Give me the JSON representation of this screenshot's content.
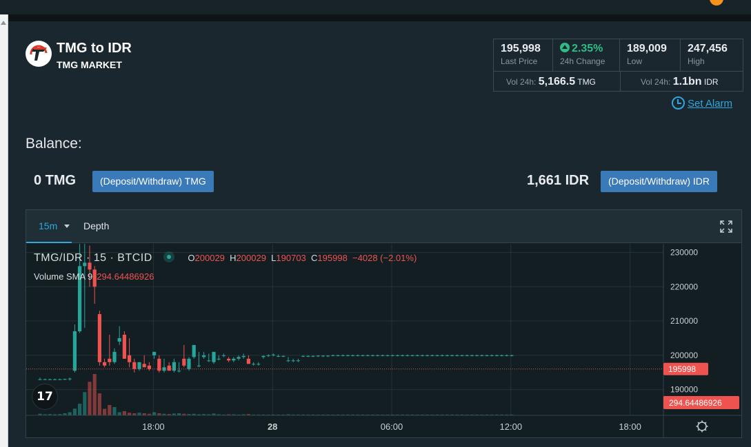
{
  "header": {
    "title": "TMG to IDR",
    "subtitle": "TMG MARKET"
  },
  "stats": {
    "last_price": "195,998",
    "last_price_label": "Last Price",
    "change": "2.35%",
    "change_label": "24h Change",
    "low": "189,009",
    "low_label": "Low",
    "high": "247,456",
    "high_label": "High",
    "vol_label_1": "Vol 24h:",
    "vol_base": "5,166.5",
    "vol_base_unit": "TMG",
    "vol_label_2": "Vol 24h:",
    "vol_quote": "1.1bn",
    "vol_quote_unit": "IDR"
  },
  "alarm_label": "Set Alarm",
  "balance": {
    "title": "Balance:",
    "base_amount": "0 TMG",
    "base_button": "(Deposit/Withdraw) TMG",
    "quote_amount": "1,661 IDR",
    "quote_button": "(Deposit/Withdraw) IDR"
  },
  "chart_tabs": {
    "interval": "15m",
    "depth": "Depth"
  },
  "legend": {
    "symbol": "TMG/IDR · 15 · BTCID",
    "o_label": "O",
    "o": "200029",
    "h_label": "H",
    "h": "200029",
    "l_label": "L",
    "l": "190703",
    "c_label": "C",
    "c": "195998",
    "change": "−4028 (−2.01%)",
    "volume_label": "Volume SMA 9",
    "volume_value": "294.64486926"
  },
  "colors": {
    "up": "#26a69a",
    "down": "#ef5350",
    "accent": "#2ea8de",
    "button": "#3a7ab8"
  },
  "chart_data": {
    "type": "candlestick",
    "price_axis": {
      "ticks": [
        190000,
        200000,
        210000,
        220000,
        230000
      ],
      "tick_labels": [
        "190000",
        "200000",
        "210000",
        "220000",
        "230000"
      ],
      "range": [
        182500,
        232500
      ]
    },
    "time_axis": {
      "labels": [
        "18:00",
        "28",
        "06:00",
        "12:00",
        "18:00"
      ],
      "label_index": [
        12,
        36,
        60,
        84,
        108
      ]
    },
    "last_price_label": "195998",
    "last_price": 195998,
    "volume_label": "294.64486926",
    "candles": [
      {
        "o": 193000,
        "h": 193500,
        "l": 192800,
        "c": 193000,
        "v": 6
      },
      {
        "o": 193000,
        "h": 193200,
        "l": 192800,
        "c": 193000,
        "v": 4
      },
      {
        "o": 193000,
        "h": 193200,
        "l": 192800,
        "c": 193000,
        "v": 5
      },
      {
        "o": 193000,
        "h": 193200,
        "l": 192800,
        "c": 193000,
        "v": 4
      },
      {
        "o": 193000,
        "h": 193200,
        "l": 192800,
        "c": 193000,
        "v": 5
      },
      {
        "o": 193000,
        "h": 193200,
        "l": 192800,
        "c": 193100,
        "v": 8
      },
      {
        "o": 193000,
        "h": 193500,
        "l": 192600,
        "c": 193200,
        "v": 12
      },
      {
        "o": 195500,
        "h": 209000,
        "l": 195000,
        "c": 207000,
        "v": 26
      },
      {
        "o": 207000,
        "h": 233000,
        "l": 206500,
        "c": 226000,
        "v": 45
      },
      {
        "o": 226000,
        "h": 233000,
        "l": 208000,
        "c": 227000,
        "v": 90
      },
      {
        "o": 227000,
        "h": 232000,
        "l": 220000,
        "c": 225000,
        "v": 130
      },
      {
        "o": 225000,
        "h": 226000,
        "l": 215000,
        "c": 220000,
        "v": 160
      },
      {
        "o": 212000,
        "h": 213000,
        "l": 197000,
        "c": 198000,
        "v": 85
      },
      {
        "o": 198000,
        "h": 199000,
        "l": 196500,
        "c": 197000,
        "v": 25
      },
      {
        "o": 199000,
        "h": 206000,
        "l": 197000,
        "c": 198000,
        "v": 40
      },
      {
        "o": 198000,
        "h": 202000,
        "l": 197500,
        "c": 201000,
        "v": 32
      },
      {
        "o": 204000,
        "h": 208500,
        "l": 203000,
        "c": 205000,
        "v": 12
      },
      {
        "o": 206000,
        "h": 207000,
        "l": 199000,
        "c": 199000,
        "v": 16
      },
      {
        "o": 200000,
        "h": 205000,
        "l": 196500,
        "c": 198000,
        "v": 10
      },
      {
        "o": 198000,
        "h": 199000,
        "l": 195000,
        "c": 196000,
        "v": 8
      },
      {
        "o": 196000,
        "h": 198000,
        "l": 195500,
        "c": 198000,
        "v": 10
      },
      {
        "o": 197500,
        "h": 200000,
        "l": 196500,
        "c": 196500,
        "v": 8
      },
      {
        "o": 197000,
        "h": 198000,
        "l": 195500,
        "c": 196000,
        "v": 6
      },
      {
        "o": 200000,
        "h": 201000,
        "l": 199000,
        "c": 201000,
        "v": 12
      },
      {
        "o": 199000,
        "h": 200000,
        "l": 195000,
        "c": 195500,
        "v": 8
      },
      {
        "o": 195500,
        "h": 199000,
        "l": 195000,
        "c": 196500,
        "v": 6
      },
      {
        "o": 197000,
        "h": 198000,
        "l": 195500,
        "c": 195500,
        "v": 5
      },
      {
        "o": 195500,
        "h": 199000,
        "l": 195000,
        "c": 198000,
        "v": 7
      },
      {
        "o": 195500,
        "h": 198000,
        "l": 195000,
        "c": 195500,
        "v": 8
      },
      {
        "o": 199000,
        "h": 203000,
        "l": 196500,
        "c": 197000,
        "v": 6
      },
      {
        "o": 196000,
        "h": 199500,
        "l": 195500,
        "c": 199000,
        "v": 5
      },
      {
        "o": 199500,
        "h": 203000,
        "l": 199000,
        "c": 203000,
        "v": 6
      },
      {
        "o": 197000,
        "h": 201000,
        "l": 196500,
        "c": 197000,
        "v": 4
      },
      {
        "o": 199500,
        "h": 201000,
        "l": 199000,
        "c": 200000,
        "v": 5
      },
      {
        "o": 198500,
        "h": 200500,
        "l": 198000,
        "c": 198500,
        "v": 4
      },
      {
        "o": 198000,
        "h": 201000,
        "l": 197500,
        "c": 201000,
        "v": 7
      },
      {
        "o": 199000,
        "h": 200000,
        "l": 198500,
        "c": 199000,
        "v": 4
      },
      {
        "o": 200000,
        "h": 200500,
        "l": 199500,
        "c": 200000,
        "v": 3
      },
      {
        "o": 199000,
        "h": 199500,
        "l": 198000,
        "c": 198500,
        "v": 4
      },
      {
        "o": 198500,
        "h": 199500,
        "l": 198000,
        "c": 199000,
        "v": 4
      },
      {
        "o": 199000,
        "h": 200000,
        "l": 198500,
        "c": 199500,
        "v": 3
      },
      {
        "o": 199500,
        "h": 200500,
        "l": 199000,
        "c": 199800,
        "v": 4
      },
      {
        "o": 199000,
        "h": 200000,
        "l": 197500,
        "c": 197500,
        "v": 5
      },
      {
        "o": 197500,
        "h": 198000,
        "l": 197000,
        "c": 197500,
        "v": 3
      },
      {
        "o": 197500,
        "h": 198000,
        "l": 197000,
        "c": 197500,
        "v": 3
      },
      {
        "o": 199500,
        "h": 200000,
        "l": 199000,
        "c": 199800,
        "v": 3
      },
      {
        "o": 199800,
        "h": 200300,
        "l": 199500,
        "c": 200000,
        "v": 3
      },
      {
        "o": 200000,
        "h": 200500,
        "l": 199700,
        "c": 200200,
        "v": 3
      },
      {
        "o": 199700,
        "h": 200200,
        "l": 199500,
        "c": 199800,
        "v": 3
      },
      {
        "o": 199800,
        "h": 200000,
        "l": 199500,
        "c": 199800,
        "v": 3
      },
      {
        "o": 198500,
        "h": 199500,
        "l": 198000,
        "c": 198500,
        "v": 4
      },
      {
        "o": 198500,
        "h": 199000,
        "l": 198000,
        "c": 198500,
        "v": 3
      },
      {
        "o": 198500,
        "h": 199000,
        "l": 198000,
        "c": 198500,
        "v": 3
      },
      {
        "o": 199800,
        "h": 200000,
        "l": 199500,
        "c": 199800,
        "v": 3
      },
      {
        "o": 199800,
        "h": 200000,
        "l": 199500,
        "c": 199800,
        "v": 3
      },
      {
        "o": 199800,
        "h": 200000,
        "l": 199500,
        "c": 199800,
        "v": 3
      },
      {
        "o": 199800,
        "h": 200000,
        "l": 199500,
        "c": 199900,
        "v": 3
      },
      {
        "o": 199800,
        "h": 200000,
        "l": 199500,
        "c": 199900,
        "v": 3
      },
      {
        "o": 199800,
        "h": 200000,
        "l": 199500,
        "c": 199900,
        "v": 3
      },
      {
        "o": 199900,
        "h": 200200,
        "l": 199700,
        "c": 200000,
        "v": 3
      },
      {
        "o": 199900,
        "h": 200200,
        "l": 199700,
        "c": 200000,
        "v": 3
      },
      {
        "o": 199900,
        "h": 200200,
        "l": 199700,
        "c": 200000,
        "v": 3
      },
      {
        "o": 199900,
        "h": 200200,
        "l": 199700,
        "c": 200000,
        "v": 3
      },
      {
        "o": 199900,
        "h": 200200,
        "l": 199700,
        "c": 200000,
        "v": 3
      },
      {
        "o": 199900,
        "h": 200200,
        "l": 199700,
        "c": 200000,
        "v": 3
      },
      {
        "o": 199900,
        "h": 200200,
        "l": 199700,
        "c": 200000,
        "v": 3
      },
      {
        "o": 199900,
        "h": 200200,
        "l": 199700,
        "c": 200000,
        "v": 3
      },
      {
        "o": 199900,
        "h": 200200,
        "l": 199700,
        "c": 200000,
        "v": 3
      },
      {
        "o": 199900,
        "h": 200200,
        "l": 199700,
        "c": 200000,
        "v": 3
      },
      {
        "o": 199900,
        "h": 200200,
        "l": 199700,
        "c": 200000,
        "v": 3
      },
      {
        "o": 199900,
        "h": 200200,
        "l": 199700,
        "c": 200000,
        "v": 3
      },
      {
        "o": 199900,
        "h": 200200,
        "l": 199700,
        "c": 200000,
        "v": 3
      },
      {
        "o": 199900,
        "h": 200200,
        "l": 199700,
        "c": 200000,
        "v": 3
      },
      {
        "o": 199900,
        "h": 200200,
        "l": 199700,
        "c": 200000,
        "v": 3
      },
      {
        "o": 199900,
        "h": 200200,
        "l": 199700,
        "c": 200000,
        "v": 3
      },
      {
        "o": 199900,
        "h": 200200,
        "l": 199700,
        "c": 200000,
        "v": 3
      },
      {
        "o": 199900,
        "h": 200200,
        "l": 199700,
        "c": 200000,
        "v": 3
      },
      {
        "o": 199900,
        "h": 200200,
        "l": 199700,
        "c": 200000,
        "v": 3
      },
      {
        "o": 199900,
        "h": 200200,
        "l": 199700,
        "c": 200000,
        "v": 3
      },
      {
        "o": 199900,
        "h": 200200,
        "l": 199700,
        "c": 200000,
        "v": 3
      },
      {
        "o": 199900,
        "h": 200200,
        "l": 199700,
        "c": 200000,
        "v": 3
      },
      {
        "o": 199900,
        "h": 200200,
        "l": 199700,
        "c": 200000,
        "v": 3
      },
      {
        "o": 199900,
        "h": 200200,
        "l": 199700,
        "c": 200000,
        "v": 3
      },
      {
        "o": 199900,
        "h": 200200,
        "l": 199700,
        "c": 200000,
        "v": 3
      },
      {
        "o": 199900,
        "h": 200200,
        "l": 199700,
        "c": 200000,
        "v": 3
      },
      {
        "o": 199900,
        "h": 200200,
        "l": 199700,
        "c": 200000,
        "v": 3
      },
      {
        "o": 199900,
        "h": 200200,
        "l": 199700,
        "c": 200000,
        "v": 3
      },
      {
        "o": 199900,
        "h": 200200,
        "l": 199700,
        "c": 200000,
        "v": 3
      },
      {
        "o": 199900,
        "h": 200200,
        "l": 199700,
        "c": 200000,
        "v": 3
      },
      {
        "o": 199900,
        "h": 200200,
        "l": 199700,
        "c": 200000,
        "v": 3
      },
      {
        "o": 199900,
        "h": 200200,
        "l": 199700,
        "c": 200000,
        "v": 3
      },
      {
        "o": 199900,
        "h": 200200,
        "l": 199700,
        "c": 200000,
        "v": 3
      },
      {
        "o": 199900,
        "h": 200200,
        "l": 199700,
        "c": 200000,
        "v": 3
      },
      {
        "o": 199900,
        "h": 200200,
        "l": 199700,
        "c": 200000,
        "v": 3
      },
      {
        "o": 199900,
        "h": 200200,
        "l": 199700,
        "c": 200000,
        "v": 3
      },
      {
        "o": 199900,
        "h": 200200,
        "l": 199700,
        "c": 200000,
        "v": 3
      }
    ]
  }
}
